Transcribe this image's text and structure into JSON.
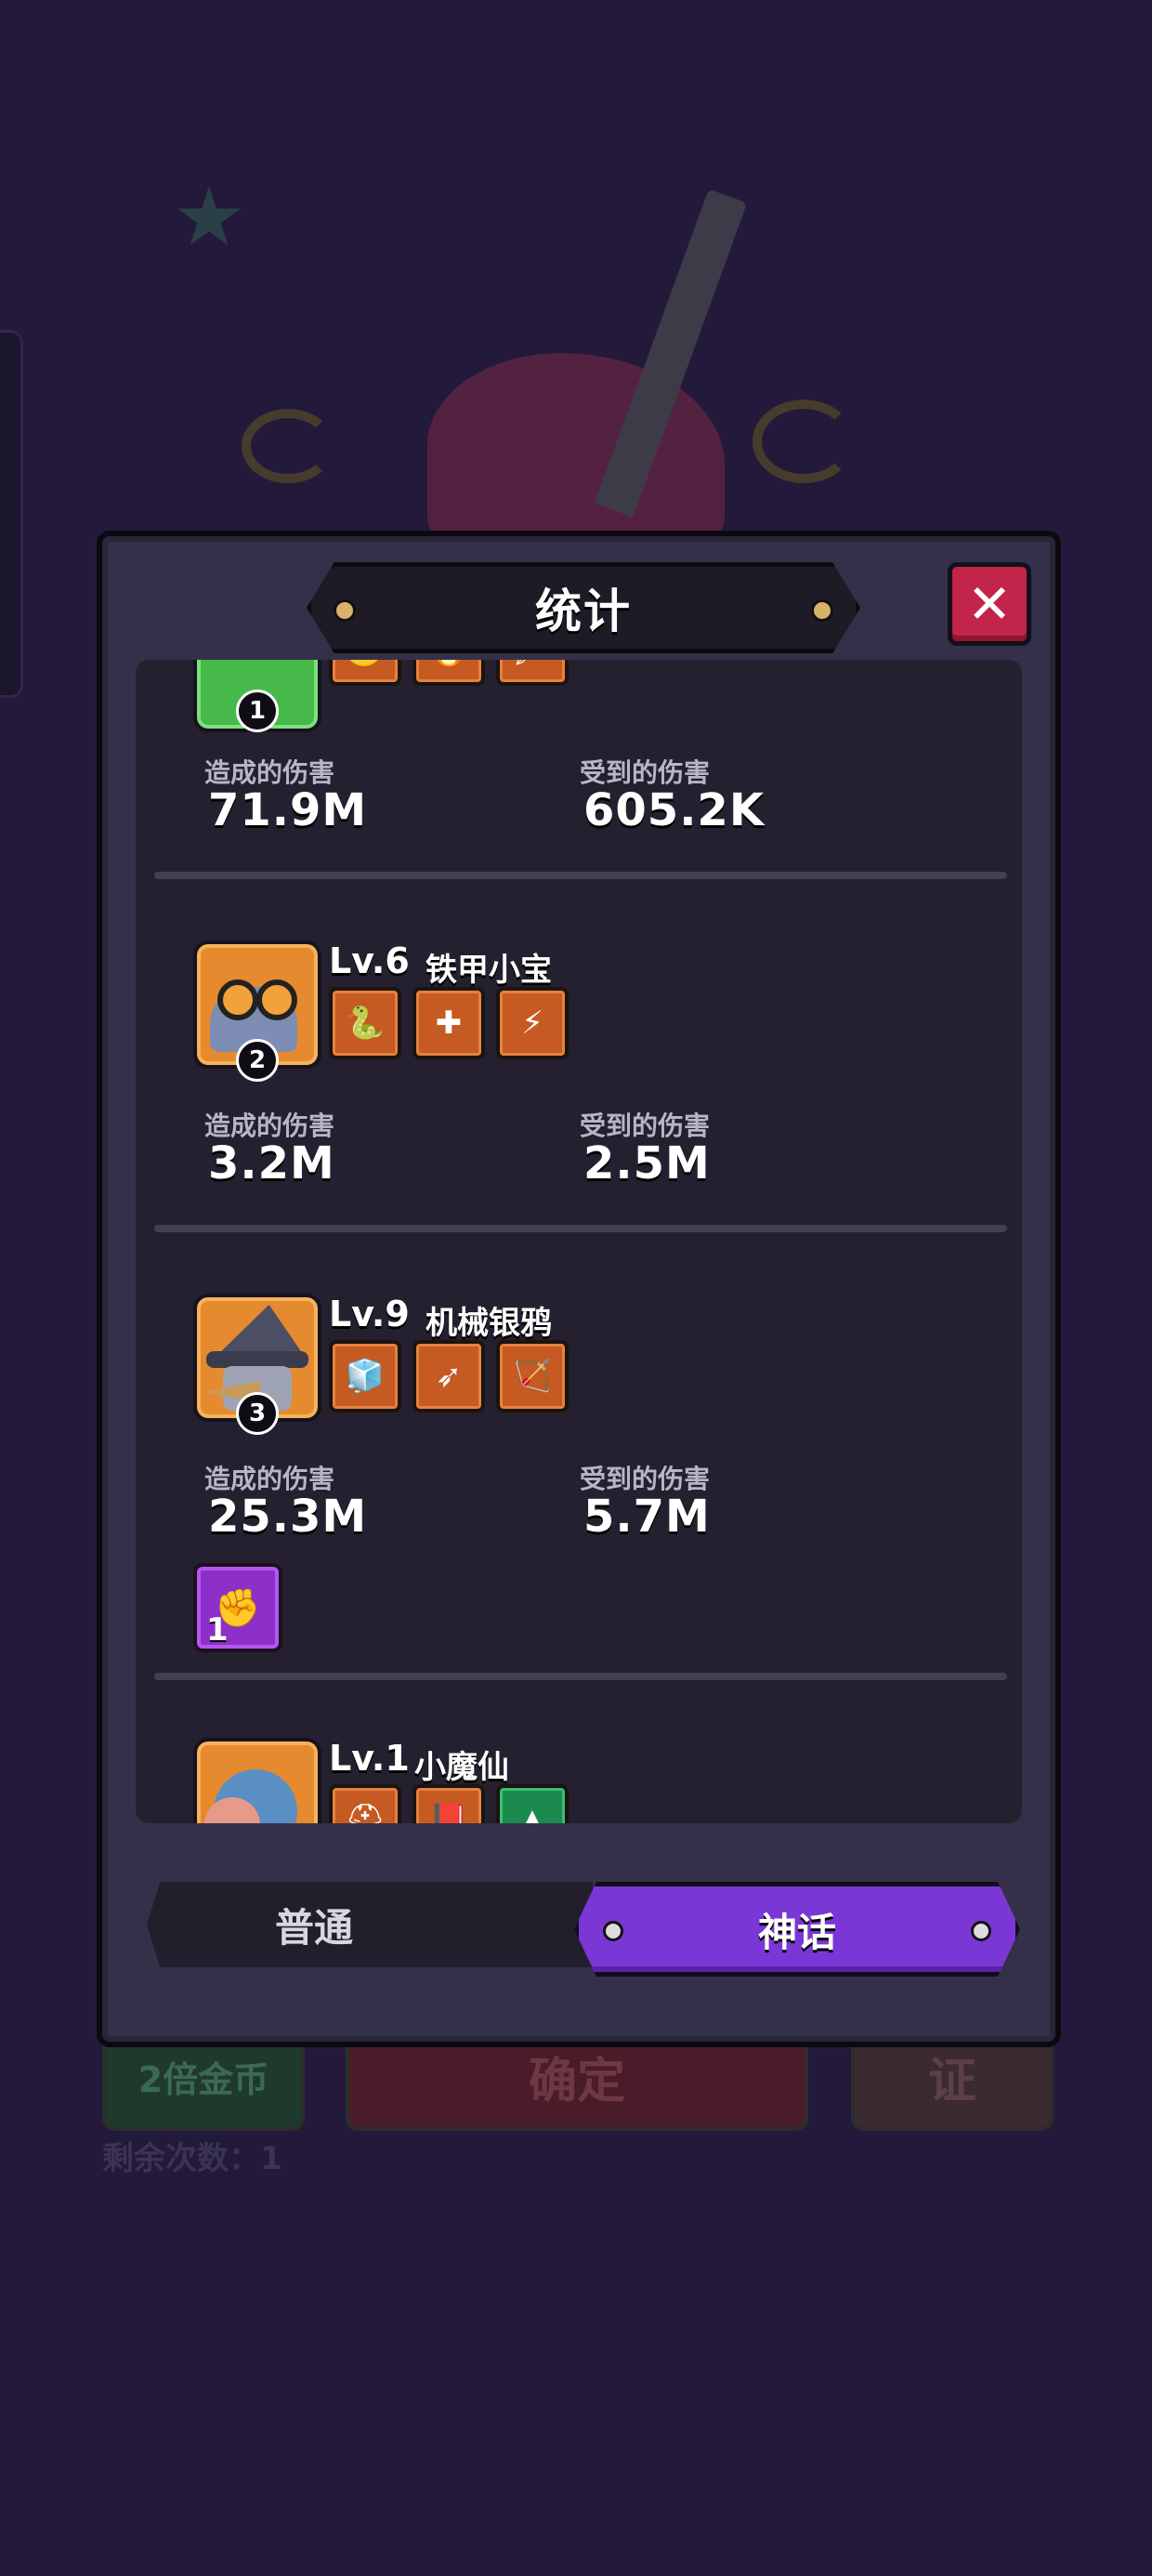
{
  "background": {
    "double_coins_label": "2倍金币",
    "confirm_label": "确定",
    "right_button_label": "证",
    "remaining_label": "剩余次数：1"
  },
  "modal": {
    "title": "统计",
    "close_icon": "close-icon"
  },
  "labels": {
    "dealt": "造成的伤害",
    "taken": "受到的伤害"
  },
  "heroes": [
    {
      "rank": "1",
      "level": "",
      "name": "",
      "damage_dealt": "71.9M",
      "damage_taken": "605.2K",
      "items": [
        "scythe-icon",
        "flame-blade-icon",
        "spear-icon"
      ]
    },
    {
      "rank": "2",
      "level": "Lv.6",
      "name": "铁甲小宝",
      "damage_dealt": "3.2M",
      "damage_taken": "2.5M",
      "items": [
        "snake-ring-icon",
        "healing-flame-icon",
        "lightning-sword-icon"
      ]
    },
    {
      "rank": "3",
      "level": "Lv.9",
      "name": "机械银鸦",
      "damage_dealt": "25.3M",
      "damage_taken": "5.7M",
      "items": [
        "magic-cube-icon",
        "spear-icon",
        "crossbow-icon"
      ],
      "relic": {
        "count": "1",
        "icon": "fist-relic-icon"
      }
    },
    {
      "rank": "",
      "level": "Lv.1",
      "name": "小魔仙",
      "items": [
        "helmet-icon",
        "book-icon",
        "crystal-icon"
      ]
    }
  ],
  "tabs": {
    "normal": "普通",
    "myth": "神话",
    "active": "myth"
  },
  "colors": {
    "accent_purple": "#7a37d6",
    "close_red": "#c2244a",
    "item_orange": "#c55a22"
  }
}
